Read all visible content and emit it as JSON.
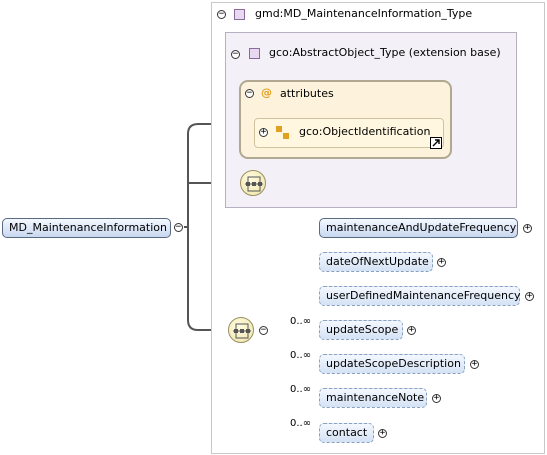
{
  "root_element": "MD_MaintenanceInformation",
  "type_name": "gmd:MD_MaintenanceInformation_Type",
  "base_type": "gco:AbstractObject_Type (extension base)",
  "attributes_label": "attributes",
  "attribute_group": "gco:ObjectIdentification",
  "attr_symbol": "@",
  "child_elements": [
    {
      "name": "maintenanceAndUpdateFrequency",
      "occurrence": "",
      "required": true
    },
    {
      "name": "dateOfNextUpdate",
      "occurrence": "",
      "required": false
    },
    {
      "name": "userDefinedMaintenanceFrequency",
      "occurrence": "",
      "required": false
    },
    {
      "name": "updateScope",
      "occurrence": "0..∞",
      "required": false
    },
    {
      "name": "updateScopeDescription",
      "occurrence": "0..∞",
      "required": false
    },
    {
      "name": "maintenanceNote",
      "occurrence": "0..∞",
      "required": false
    },
    {
      "name": "contact",
      "occurrence": "0..∞",
      "required": false
    }
  ],
  "colors": {
    "mandatory_fill": "#c8d8f0",
    "optional_fill": "#d4e2f4",
    "attributes_fill": "#fdf3dc",
    "base_type_fill": "#f4f0f8",
    "sequence_fill": "#ede4a8"
  }
}
